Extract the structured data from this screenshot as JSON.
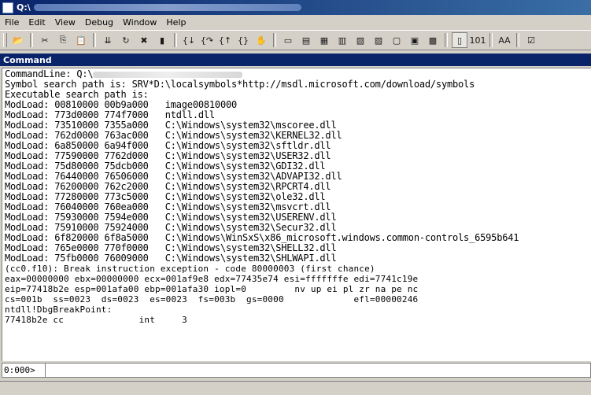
{
  "window": {
    "title": "Q:\\"
  },
  "menubar": [
    "File",
    "Edit",
    "View",
    "Debug",
    "Window",
    "Help"
  ],
  "toolbar": {
    "buttons": [
      {
        "icon": "open-folder-icon",
        "glyph": "📂"
      },
      {
        "sep": true
      },
      {
        "icon": "cut-icon",
        "glyph": "✂"
      },
      {
        "icon": "copy-icon",
        "glyph": "⎘"
      },
      {
        "icon": "paste-icon",
        "glyph": "📋"
      },
      {
        "sep": true
      },
      {
        "icon": "go-icon",
        "glyph": "⇊"
      },
      {
        "icon": "restart-icon",
        "glyph": "↻"
      },
      {
        "icon": "stop-debugging-icon",
        "glyph": "✖"
      },
      {
        "icon": "break-icon",
        "glyph": "▮"
      },
      {
        "sep": true
      },
      {
        "icon": "step-into-icon",
        "glyph": "{↓"
      },
      {
        "icon": "step-over-icon",
        "glyph": "{↷"
      },
      {
        "icon": "step-out-icon",
        "glyph": "{↑"
      },
      {
        "icon": "run-to-cursor-icon",
        "glyph": "{}"
      },
      {
        "icon": "hand-icon",
        "glyph": "✋"
      },
      {
        "sep": true
      },
      {
        "icon": "command-window-icon",
        "glyph": "▭"
      },
      {
        "icon": "watch-icon",
        "glyph": "▤"
      },
      {
        "icon": "locals-icon",
        "glyph": "▦"
      },
      {
        "icon": "registers-icon",
        "glyph": "▥"
      },
      {
        "icon": "memory-icon",
        "glyph": "▧"
      },
      {
        "icon": "call-stack-icon",
        "glyph": "▨"
      },
      {
        "icon": "disassembly-icon",
        "glyph": "▢"
      },
      {
        "icon": "scratch-pad-icon",
        "glyph": "▣"
      },
      {
        "icon": "processes-icon",
        "glyph": "▩"
      },
      {
        "sep": true
      },
      {
        "icon": "source-mode-icon",
        "glyph": "▯",
        "pressed": true
      },
      {
        "icon": "binary-mode-icon",
        "glyph": "101"
      },
      {
        "sep": true
      },
      {
        "icon": "font-icon",
        "glyph": "AA"
      },
      {
        "sep": true
      },
      {
        "icon": "options-icon",
        "glyph": "☑"
      }
    ]
  },
  "pane": {
    "title": "Command"
  },
  "output": {
    "cmdline_prefix": "CommandLine: Q:\\",
    "lines": [
      "Symbol search path is: SRV*D:\\localsymbols*http://msdl.microsoft.com/download/symbols",
      "Executable search path is:",
      "ModLoad: 00810000 00b9a000   image00810000",
      "ModLoad: 773d0000 774f7000   ntdll.dll",
      "ModLoad: 73510000 7355a000   C:\\Windows\\system32\\mscoree.dll",
      "ModLoad: 762d0000 763ac000   C:\\Windows\\system32\\KERNEL32.dll",
      "ModLoad: 6a850000 6a94f000   C:\\Windows\\system32\\sftldr.dll",
      "ModLoad: 77590000 7762d000   C:\\Windows\\system32\\USER32.dll",
      "ModLoad: 75d80000 75dcb000   C:\\Windows\\system32\\GDI32.dll",
      "ModLoad: 76440000 76506000   C:\\Windows\\system32\\ADVAPI32.dll",
      "ModLoad: 76200000 762c2000   C:\\Windows\\system32\\RPCRT4.dll",
      "ModLoad: 77280000 773c5000   C:\\Windows\\system32\\ole32.dll",
      "ModLoad: 76040000 760ea000   C:\\Windows\\system32\\msvcrt.dll",
      "ModLoad: 75930000 7594e000   C:\\Windows\\system32\\USERENV.dll",
      "ModLoad: 75910000 75924000   C:\\Windows\\system32\\Secur32.dll",
      "ModLoad: 6f820000 6f8a5000   C:\\Windows\\WinSxS\\x86_microsoft.windows.common-controls_6595b641",
      "ModLoad: 765e0000 770f0000   C:\\Windows\\system32\\SHELL32.dll",
      "ModLoad: 75fb0000 76009000   C:\\Windows\\system32\\SHLWAPI.dll",
      "(cc0.f10): Break instruction exception - code 80000003 (first chance)",
      "eax=00000000 ebx=00000000 ecx=001af9e8 edx=77435e74 esi=fffffffe edi=7741c19e",
      "eip=77418b2e esp=001afa00 ebp=001afa30 iopl=0         nv up ei pl zr na pe nc",
      "cs=001b  ss=0023  ds=0023  es=0023  fs=003b  gs=0000             efl=00000246",
      "ntdll!DbgBreakPoint:",
      "77418b2e cc              int     3"
    ],
    "narrow_from": 18
  },
  "command": {
    "prompt": "0:000>",
    "value": ""
  }
}
